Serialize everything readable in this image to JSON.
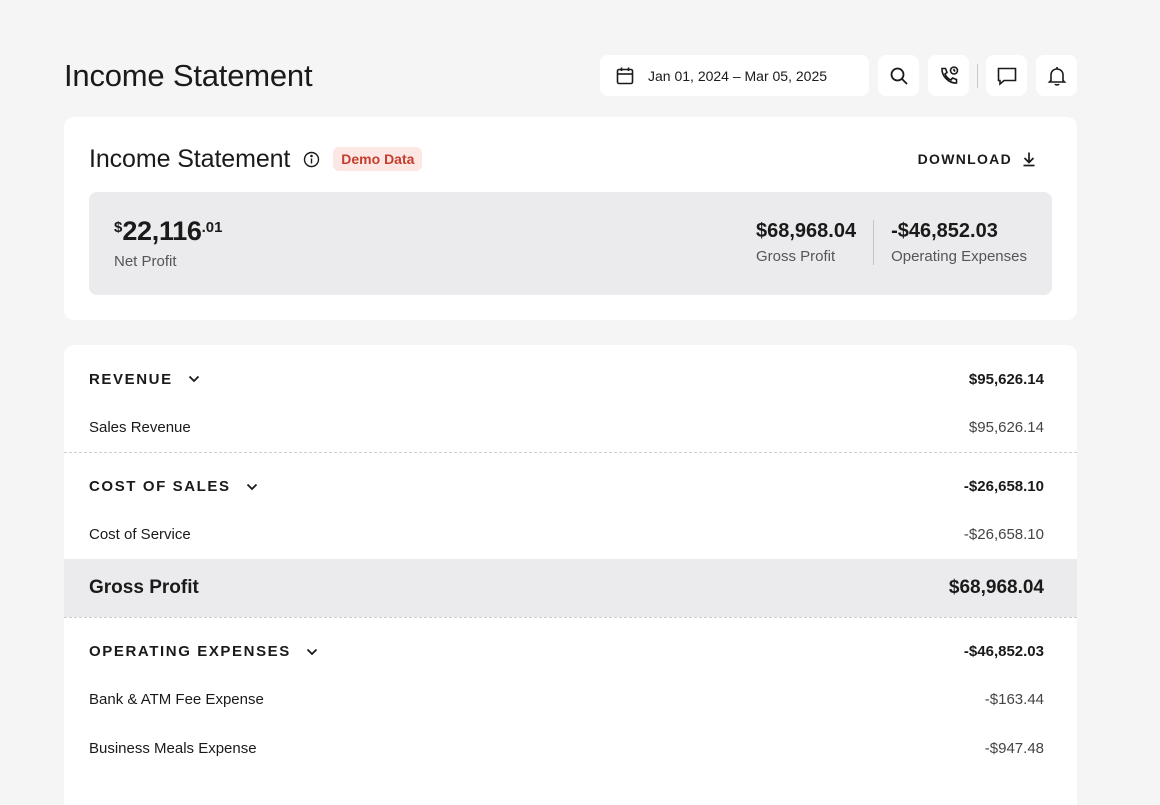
{
  "header": {
    "title": "Income Statement",
    "date_range": "Jan 01, 2024 – Mar 05, 2025"
  },
  "summary": {
    "title": "Income Statement",
    "badge": "Demo Data",
    "download_label": "DOWNLOAD",
    "net_profit": {
      "currency": "$",
      "whole": "22,116",
      "decimal": ".01",
      "label": "Net Profit"
    },
    "gross_profit": {
      "value": "$68,968.04",
      "label": "Gross Profit"
    },
    "operating_expenses": {
      "value": "-$46,852.03",
      "label": "Operating Expenses"
    }
  },
  "statement": {
    "revenue": {
      "label": "REVENUE",
      "total": "$95,626.14",
      "items": [
        {
          "label": "Sales Revenue",
          "value": "$95,626.14"
        }
      ]
    },
    "cost_of_sales": {
      "label": "COST OF SALES",
      "total": "-$26,658.10",
      "items": [
        {
          "label": "Cost of Service",
          "value": "-$26,658.10"
        }
      ]
    },
    "gross_profit": {
      "label": "Gross Profit",
      "value": "$68,968.04"
    },
    "operating_expenses": {
      "label": "OPERATING EXPENSES",
      "total": "-$46,852.03",
      "items": [
        {
          "label": "Bank & ATM Fee Expense",
          "value": "-$163.44"
        },
        {
          "label": "Business Meals Expense",
          "value": "-$947.48"
        }
      ]
    }
  },
  "colors": {
    "page_bg": "#f5f5f5",
    "card_bg": "#ffffff",
    "stats_bg": "#ebebed",
    "badge_bg": "#fde7e4",
    "badge_text": "#c53d2c"
  },
  "icons": [
    "calendar-icon",
    "search-icon",
    "phone-icon",
    "chat-icon",
    "bell-icon",
    "info-icon",
    "download-icon",
    "chevron-down-icon"
  ]
}
